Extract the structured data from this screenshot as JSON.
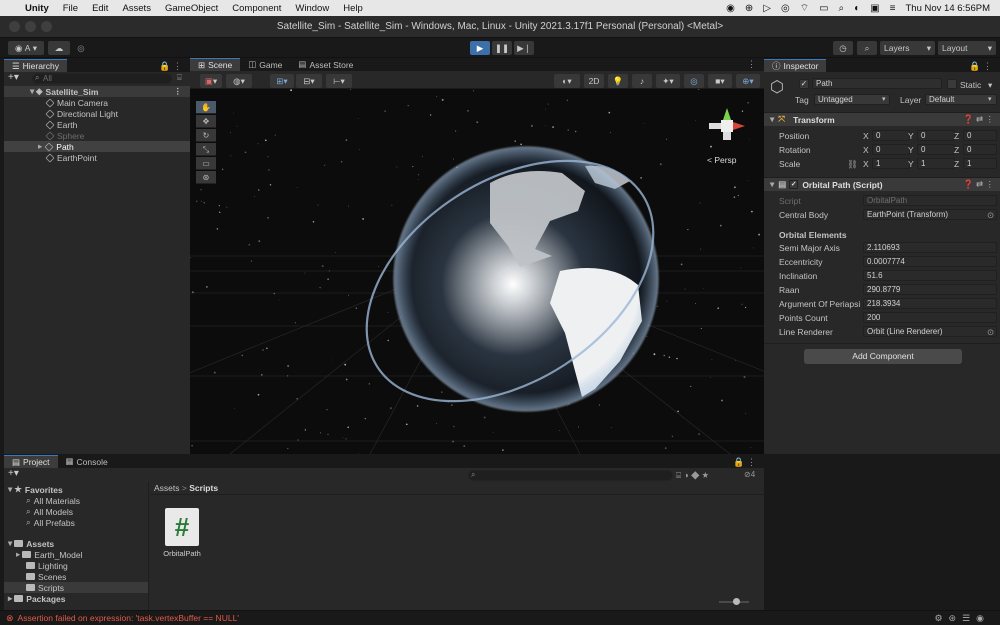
{
  "menubar": {
    "app_name": "Unity",
    "items": [
      "File",
      "Edit",
      "Assets",
      "GameObject",
      "Component",
      "Window",
      "Help"
    ],
    "datetime": "Thu Nov 14  6:56PM"
  },
  "window": {
    "title": "Satellite_Sim - Satellite_Sim - Windows, Mac, Linux - Unity 2021.3.17f1 Personal (Personal) <Metal>"
  },
  "toolbar": {
    "account_label": "A",
    "layers_label": "Layers",
    "layout_label": "Layout"
  },
  "hierarchy": {
    "tab_label": "Hierarchy",
    "search_placeholder": "All",
    "scene_name": "Satellite_Sim",
    "items": [
      {
        "label": "Main Camera"
      },
      {
        "label": "Directional Light"
      },
      {
        "label": "Earth"
      },
      {
        "label": "Sphere"
      },
      {
        "label": "Path"
      },
      {
        "label": "EarthPoint"
      }
    ]
  },
  "scene_view": {
    "tabs": [
      "Scene",
      "Game",
      "Asset Store"
    ],
    "mode_2d": "2D",
    "persp_label": "< Persp"
  },
  "inspector": {
    "tab_label": "Inspector",
    "object_name": "Path",
    "static_label": "Static",
    "tag_label": "Tag",
    "tag_value": "Untagged",
    "layer_label": "Layer",
    "layer_value": "Default",
    "transform": {
      "title": "Transform",
      "rows": [
        {
          "label": "Position",
          "x": "0",
          "y": "0",
          "z": "0"
        },
        {
          "label": "Rotation",
          "x": "0",
          "y": "0",
          "z": "0"
        },
        {
          "label": "Scale",
          "x": "1",
          "y": "1",
          "z": "1"
        }
      ]
    },
    "orbital_path": {
      "title": "Orbital Path (Script)",
      "script_label": "Script",
      "script_value": "OrbitalPath",
      "central_body_label": "Central Body",
      "central_body_value": "EarthPoint (Transform)",
      "section_label": "Orbital Elements",
      "fields": [
        {
          "label": "Semi Major Axis",
          "value": "2.110693"
        },
        {
          "label": "Eccentricity",
          "value": "0.0007774"
        },
        {
          "label": "Inclination",
          "value": "51.6"
        },
        {
          "label": "Raan",
          "value": "290.8779"
        },
        {
          "label": "Argument Of Periapsi",
          "value": "218.3934"
        },
        {
          "label": "Points Count",
          "value": "200"
        }
      ],
      "line_renderer_label": "Line Renderer",
      "line_renderer_value": "Orbit (Line Renderer)"
    },
    "add_component_label": "Add Component"
  },
  "project": {
    "tabs": [
      "Project",
      "Console"
    ],
    "favorites_label": "Favorites",
    "favorites": [
      "All Materials",
      "All Models",
      "All Prefabs"
    ],
    "assets_label": "Assets",
    "asset_folders": [
      "Earth_Model",
      "Lighting",
      "Scenes",
      "Scripts"
    ],
    "packages_label": "Packages",
    "breadcrumb_root": "Assets",
    "breadcrumb_sep": ">",
    "breadcrumb_current": "Scripts",
    "files": [
      {
        "name": "OrbitalPath",
        "glyph": "#"
      }
    ],
    "hidden_count": "4"
  },
  "status": {
    "error_message": "Assertion failed on expression: 'task.vertexBuffer == NULL'"
  },
  "colors": {
    "selection": "#2c5d87",
    "accent": "#3a79bb",
    "error": "#e35a4a",
    "play_active": "#3d6fa8"
  }
}
